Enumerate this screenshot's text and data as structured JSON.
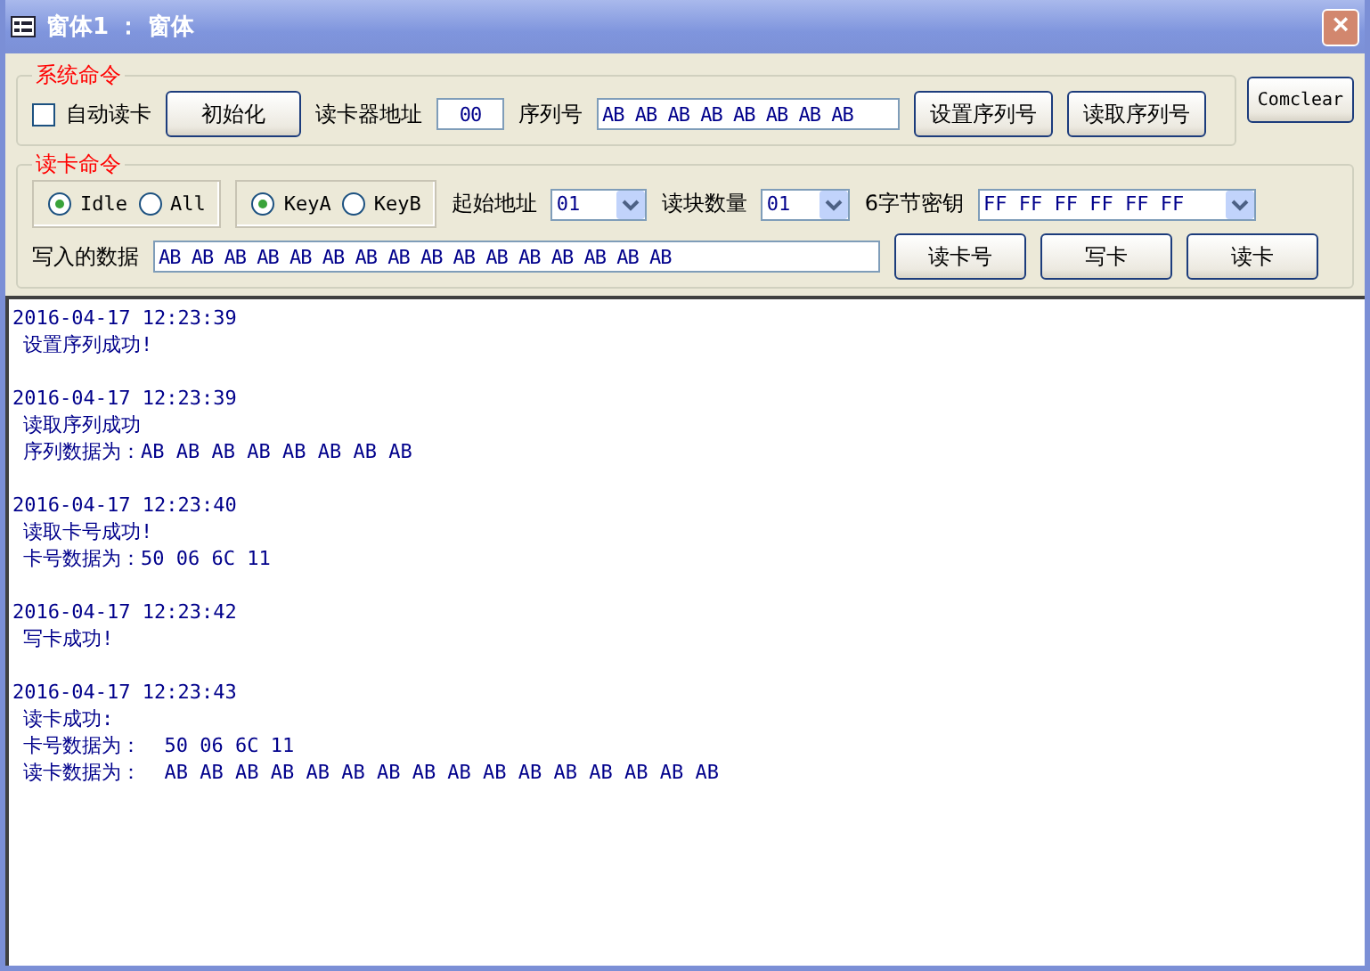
{
  "window": {
    "title": "窗体1 ： 窗体",
    "close": "×"
  },
  "system_group": {
    "legend": "系统命令",
    "auto_read": {
      "label": "自动读卡",
      "checked": false
    },
    "init_button": "初始化",
    "address_label": "读卡器地址",
    "address_value": "00",
    "serial_label": "序列号",
    "serial_value": "AB AB AB AB AB AB AB AB",
    "buttons": [
      "设置序列号",
      "读取序列号"
    ]
  },
  "comclear_button": "Comclear",
  "read_group": {
    "legend": "读卡命令",
    "mode_radios": [
      {
        "label": "Idle",
        "selected": true
      },
      {
        "label": "All",
        "selected": false
      }
    ],
    "key_radios": [
      {
        "label": "KeyA",
        "selected": true
      },
      {
        "label": "KeyB",
        "selected": false
      }
    ],
    "start_label": "起始地址",
    "start_value": "01",
    "count_label": "读块数量",
    "count_value": "01",
    "key_label": "6字节密钥",
    "key_value": "FF FF FF FF FF FF",
    "write_label": "写入的数据",
    "write_value": "AB AB AB AB AB AB AB AB AB AB AB AB AB AB AB AB",
    "buttons": [
      "读卡号",
      "写卡",
      "读卡"
    ]
  },
  "log": [
    {
      "time": "2016-04-17 12:23:39",
      "lines": [
        "设置序列成功!"
      ]
    },
    {
      "time": "2016-04-17 12:23:39",
      "lines": [
        "读取序列成功",
        "序列数据为：AB AB AB AB AB AB AB AB"
      ]
    },
    {
      "time": "2016-04-17 12:23:40",
      "lines": [
        "读取卡号成功!",
        "卡号数据为：50 06 6C 11"
      ]
    },
    {
      "time": "2016-04-17 12:23:42",
      "lines": [
        "写卡成功!"
      ]
    },
    {
      "time": "2016-04-17 12:23:43",
      "lines": [
        "读卡成功:",
        "卡号数据为：  50 06 6C 11",
        "读卡数据为：  AB AB AB AB AB AB AB AB AB AB AB AB AB AB AB AB"
      ]
    }
  ]
}
